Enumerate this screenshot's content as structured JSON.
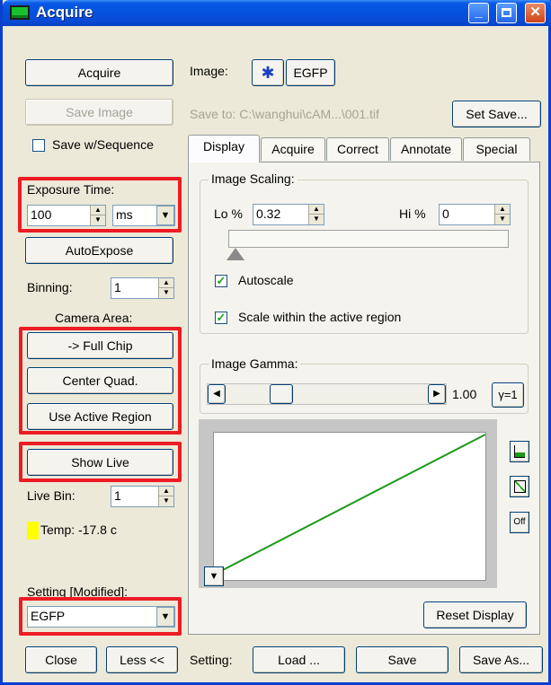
{
  "window": {
    "title": "Acquire"
  },
  "left": {
    "acquire_label": "Acquire",
    "save_image_label": "Save Image",
    "save_seq_label": "Save w/Sequence",
    "exposure_label": "Exposure Time:",
    "exposure_value": "100",
    "exposure_unit": "ms",
    "autoexpose_label": "AutoExpose",
    "binning_label": "Binning:",
    "binning_value": "1",
    "camera_area_label": "Camera Area:",
    "full_chip_label": "-> Full Chip",
    "center_quad_label": "Center Quad.",
    "use_active_label": "Use Active Region",
    "show_live_label": "Show Live",
    "live_bin_label": "Live Bin:",
    "live_bin_value": "1",
    "temp_label": "Temp: -17.8 c",
    "temp_color": "#ffff00",
    "setting_label": "Setting [Modified]:",
    "setting_value": "EGFP"
  },
  "right": {
    "image_label": "Image:",
    "image_name": "EGFP",
    "save_to": "Save to: C:\\wanghui\\cAM...\\001.tif",
    "set_save_label": "Set Save...",
    "tabs": [
      "Display",
      "Acquire",
      "Correct",
      "Annotate",
      "Special"
    ],
    "scaling_title": "Image Scaling:",
    "lo_label": "Lo %",
    "lo_value": "0.32",
    "hi_label": "Hi %",
    "hi_value": "0",
    "autoscale_label": "Autoscale",
    "scale_active_label": "Scale within the active region",
    "gamma_title": "Image Gamma:",
    "gamma_value": "1.00",
    "gamma_btn": "γ=1",
    "off_label": "Off",
    "reset_label": "Reset Display",
    "curve_color": "#1a9a1a"
  },
  "bottom": {
    "close_label": "Close",
    "less_label": "Less <<",
    "setting_label": "Setting:",
    "load_label": "Load ...",
    "save_label": "Save",
    "save_as_label": "Save As..."
  }
}
